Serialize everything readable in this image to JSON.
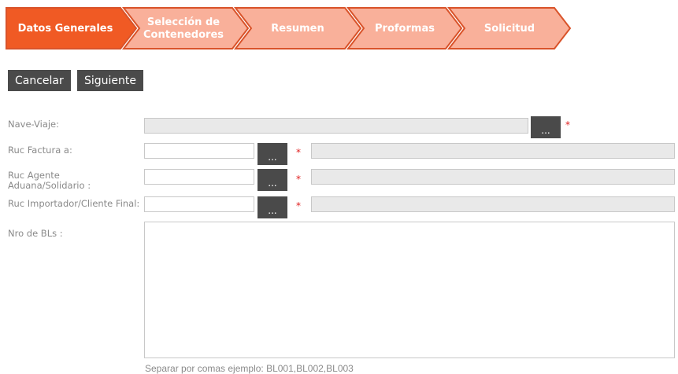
{
  "wizard": {
    "steps": [
      {
        "label": "Datos Generales",
        "active": true
      },
      {
        "label": "Selección de Contenedores",
        "active": false
      },
      {
        "label": "Resumen",
        "active": false
      },
      {
        "label": "Proformas",
        "active": false
      },
      {
        "label": "Solicitud",
        "active": false
      }
    ],
    "colors": {
      "active": "#f05a24",
      "inactive": "#f9b09a",
      "border": "#d9532a"
    }
  },
  "actions": {
    "cancel_label": "Cancelar",
    "next_label": "Siguiente"
  },
  "form": {
    "nave_viaje": {
      "label": "Nave-Viaje:",
      "value": ""
    },
    "ruc_factura": {
      "label": "Ruc Factura a:",
      "value": "",
      "name_value": ""
    },
    "ruc_agente": {
      "label": "Ruc Agente Aduana/Solidario :",
      "value": "",
      "name_value": ""
    },
    "ruc_importador": {
      "label": "Ruc Importador/Cliente Final:",
      "value": "",
      "name_value": ""
    },
    "nro_bls": {
      "label": "Nro de BLs :",
      "value": "",
      "hint": "Separar por comas ejemplo: BL001,BL002,BL003"
    },
    "lookup_label": "...",
    "required_mark": "*"
  }
}
